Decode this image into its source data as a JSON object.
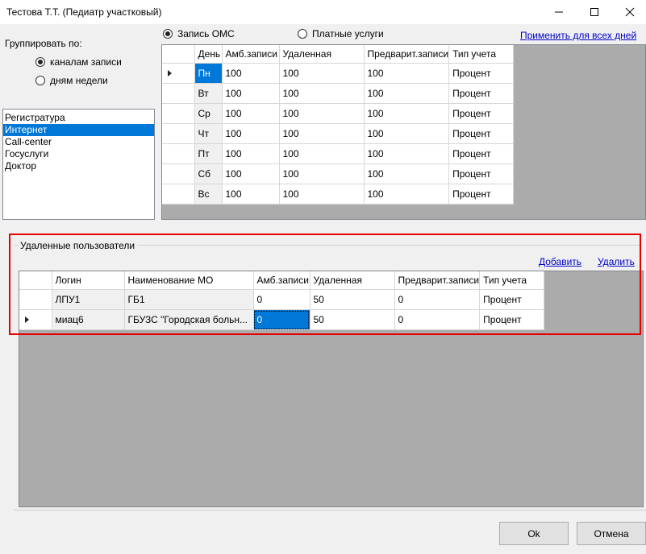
{
  "window": {
    "title": "Тестова Т.Т. (Педиатр участковый)"
  },
  "group_by": {
    "label": "Группировать по:",
    "options": [
      {
        "label": "каналам записи",
        "selected": true
      },
      {
        "label": "дням недели",
        "selected": false
      }
    ]
  },
  "channels": [
    "Регистратура",
    "Интернет",
    "Call-center",
    "Госуслуги",
    "Доктор"
  ],
  "selected_channel_index": 1,
  "payment_type": {
    "options": [
      {
        "label": "Запись ОМС",
        "selected": true
      },
      {
        "label": "Платные услуги",
        "selected": false
      }
    ]
  },
  "apply_all_link": "Применить для всех дней",
  "schedule": {
    "columns": [
      "День",
      "Амб.записи",
      "Удаленная",
      "Предварит.записи",
      "Тип учета"
    ],
    "rows": [
      [
        "Пн",
        "100",
        "100",
        "100",
        "Процент"
      ],
      [
        "Вт",
        "100",
        "100",
        "100",
        "Процент"
      ],
      [
        "Ср",
        "100",
        "100",
        "100",
        "Процент"
      ],
      [
        "Чт",
        "100",
        "100",
        "100",
        "Процент"
      ],
      [
        "Пт",
        "100",
        "100",
        "100",
        "Процент"
      ],
      [
        "Сб",
        "100",
        "100",
        "100",
        "Процент"
      ],
      [
        "Вс",
        "100",
        "100",
        "100",
        "Процент"
      ]
    ]
  },
  "remote_users": {
    "title": "Удаленные пользователи",
    "add_link": "Добавить",
    "delete_link": "Удалить",
    "columns": [
      "Логин",
      "Наименование МО",
      "Амб.записи",
      "Удаленная",
      "Предварит.записи",
      "Тип учета"
    ],
    "rows": [
      [
        "ЛПУ1",
        "ГБ1",
        "0",
        "50",
        "0",
        "Процент"
      ],
      [
        "миац6",
        "ГБУЗС \"Городская больн...",
        "0",
        "50",
        "0",
        "Процент"
      ]
    ]
  },
  "buttons": {
    "ok": "Ok",
    "cancel": "Отмена"
  },
  "icons": {
    "minimize": "minimize-icon",
    "maximize": "maximize-icon",
    "close": "close-icon"
  }
}
